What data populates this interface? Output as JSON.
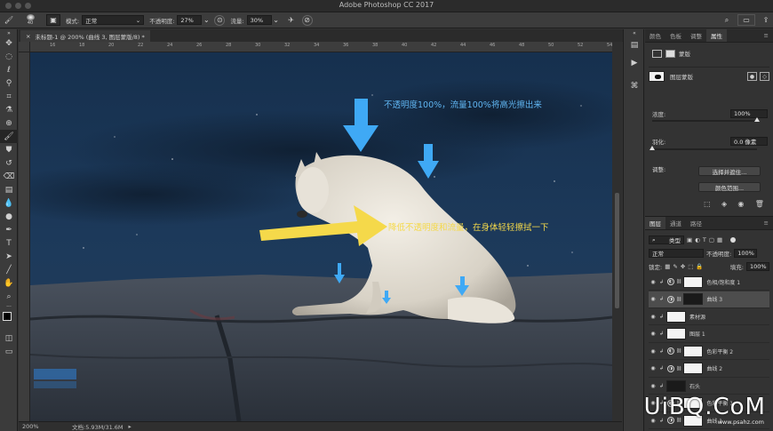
{
  "window": {
    "title": "Adobe Photoshop CC 2017"
  },
  "options": {
    "brush_size": "40",
    "mode_label": "模式:",
    "mode_value": "正常",
    "opacity_label": "不透明度:",
    "opacity_value": "27%",
    "flow_label": "流量:",
    "flow_value": "30%"
  },
  "document": {
    "tab_label": "未标题-1 @ 200% (曲线 3, 图层蒙版/8) *",
    "ruler_ticks": [
      "16",
      "18",
      "20",
      "22",
      "24",
      "26",
      "28",
      "30",
      "32",
      "34",
      "36",
      "38",
      "40",
      "42",
      "44",
      "46",
      "48",
      "50",
      "52",
      "54"
    ],
    "zoom": "200%",
    "doc_info": "文档:5.93M/31.6M"
  },
  "annotations": {
    "top_note": "不透明度100%，流量100%将高光擦出来",
    "middle_note": "降低不透明度和流量，在身体轻轻擦拭一下"
  },
  "properties_panel": {
    "tabs": [
      "颜色",
      "色板",
      "调整",
      "属性"
    ],
    "active_tab": "属性",
    "mask_title": "蒙版",
    "layer_mask_label": "图层蒙版",
    "density_label": "浓度:",
    "density_value": "100%",
    "feather_label": "羽化:",
    "feather_value": "0.0 像素",
    "adjust_label": "调整:",
    "select_mask_button": "选择并遮住...",
    "color_range_button": "颜色范围...",
    "density_level": 100
  },
  "layers_panel": {
    "tabs": [
      "图层",
      "通道",
      "路径"
    ],
    "active_tab": "图层",
    "filter_kind": "类型",
    "blend_mode": "正常",
    "opacity_label": "不透明度:",
    "opacity_value": "100%",
    "lock_label": "锁定:",
    "fill_label": "填充:",
    "fill_value": "100%",
    "layers": [
      {
        "name": "色相/饱和度 1",
        "thumb": "white",
        "adj": "◐"
      },
      {
        "name": "曲线 3",
        "thumb": "dark",
        "adj": "◑",
        "selected": true
      },
      {
        "name": "素材源",
        "thumb": "white",
        "adj": ""
      },
      {
        "name": "图层 1",
        "thumb": "white",
        "adj": ""
      },
      {
        "name": "色彩平衡 2",
        "thumb": "white",
        "adj": "◐"
      },
      {
        "name": "曲线 2",
        "thumb": "white",
        "adj": "◑"
      },
      {
        "name": "石头",
        "thumb": "dark",
        "adj": ""
      },
      {
        "name": "色彩平衡 1",
        "thumb": "white",
        "adj": "◐"
      },
      {
        "name": "曲线 1",
        "thumb": "white",
        "adj": "◑"
      }
    ]
  },
  "watermark": {
    "text": "UiBQ.CoM",
    "sub": "www.psahz.com"
  },
  "colors": {
    "accent_blue": "#3fa9f5",
    "annotation_yellow": "#f5d94a",
    "sky": "#1c3453",
    "rock": "#3e4550"
  }
}
